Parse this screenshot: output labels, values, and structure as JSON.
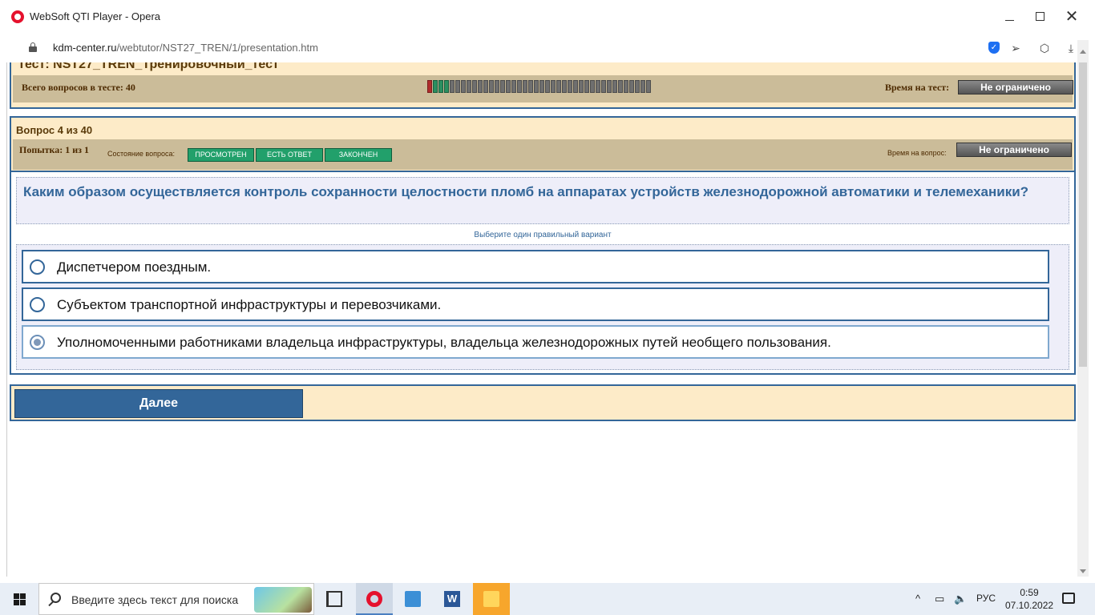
{
  "window": {
    "title": "WebSoft QTI Player - Opera"
  },
  "address_bar": {
    "domain": "kdm-center.ru",
    "path": "/webtutor/NST27_TREN/1/presentation.htm"
  },
  "test_header": {
    "title": "Тест: NST27_TREN_Тренировочный_тест",
    "total_questions_label": "Всего вопросов в тесте: 40",
    "time_for_test_label": "Время на тест:",
    "time_for_test_value": "Не ограничено",
    "progress": {
      "total": 40,
      "current": 4,
      "answered": 3
    }
  },
  "question_header": {
    "number_label": "Вопрос 4 из 40",
    "attempt_label": "Попытка: 1 из 1",
    "state_label": "Состояние вопроса:",
    "states": [
      "ПРОСМОТРЕН",
      "ЕСТЬ ОТВЕТ",
      "ЗАКОНЧЕН"
    ],
    "time_for_question_label": "Время на вопрос:",
    "time_for_question_value": "Не ограничено"
  },
  "question": {
    "text": "Каким образом осуществляется контроль сохранности целостности пломб на аппаратах устройств железнодорожной автоматики и телемеханики?",
    "hint": "Выберите один правильный вариант",
    "answers": [
      {
        "label": "Диспетчером поездным.",
        "selected": false
      },
      {
        "label": "Субъектом транспортной инфраструктуры и перевозчиками.",
        "selected": false
      },
      {
        "label": "Уполномоченными работниками владельца инфраструктуры, владельца железнодорожных путей необщего пользования.",
        "selected": true
      }
    ]
  },
  "navigation": {
    "next_label": "Далее"
  },
  "taskbar": {
    "search_placeholder": "Введите здесь текст для поиска",
    "language": "РУС",
    "time": "0:59",
    "date": "07.10.2022"
  },
  "colors": {
    "accent": "#336699",
    "panel_bg": "#fdebc8",
    "info_bg": "#cbbc99",
    "state_green": "#22a06b"
  }
}
